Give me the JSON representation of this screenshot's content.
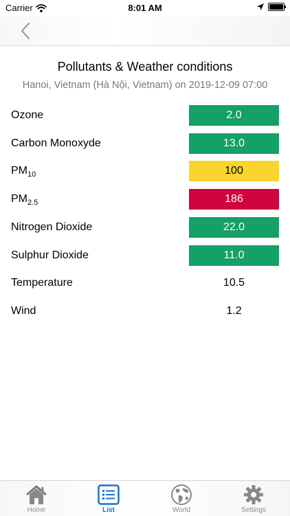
{
  "status_bar": {
    "carrier": "Carrier",
    "time": "8:01 AM"
  },
  "header": {
    "title": "Pollutants & Weather conditions",
    "subtitle": "Hanoi, Vietnam (Hà Nội, Vietnam) on 2019-12-09 07:00"
  },
  "rows": [
    {
      "label": "Ozone",
      "value": "2.0",
      "color": "#15a066"
    },
    {
      "label": "Carbon Monoxyde",
      "value": "13.0",
      "color": "#15a066"
    },
    {
      "label": "PM",
      "sub": "10",
      "value": "100",
      "color": "#fad52e"
    },
    {
      "label": "PM",
      "sub": "2.5",
      "value": "186",
      "color": "#d0043c"
    },
    {
      "label": "Nitrogen Dioxide",
      "value": "22.0",
      "color": "#15a066"
    },
    {
      "label": "Sulphur Dioxide",
      "value": "11.0",
      "color": "#15a066"
    },
    {
      "label": "Temperature",
      "value": "10.5"
    },
    {
      "label": "Wind",
      "value": "1.2"
    }
  ],
  "tabs": [
    {
      "label": "Home",
      "icon": "home-icon"
    },
    {
      "label": "List",
      "icon": "list-icon",
      "active": true
    },
    {
      "label": "World",
      "icon": "globe-icon"
    },
    {
      "label": "Settings",
      "icon": "gear-icon"
    }
  ],
  "accent_color": "#1a73c8"
}
